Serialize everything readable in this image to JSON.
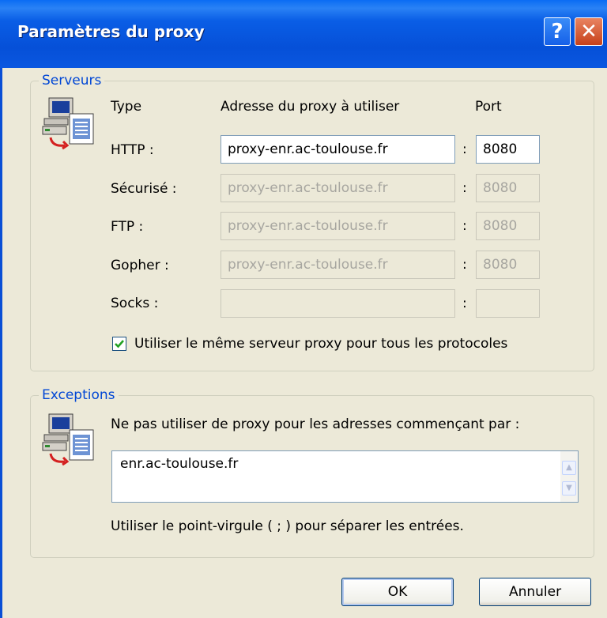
{
  "window": {
    "title": "Paramètres du proxy",
    "help_glyph": "?",
    "close_glyph": "✕"
  },
  "servers": {
    "legend": "Serveurs",
    "icon": "network-server-icon",
    "headers": {
      "type": "Type",
      "address": "Adresse du proxy à utiliser",
      "port": "Port"
    },
    "separator": ":",
    "rows": [
      {
        "label": "HTTP :",
        "address": "proxy-enr.ac-toulouse.fr",
        "port": "8080",
        "enabled": true
      },
      {
        "label": "Sécurisé :",
        "address": "proxy-enr.ac-toulouse.fr",
        "port": "8080",
        "enabled": false
      },
      {
        "label": "FTP :",
        "address": "proxy-enr.ac-toulouse.fr",
        "port": "8080",
        "enabled": false
      },
      {
        "label": "Gopher :",
        "address": "proxy-enr.ac-toulouse.fr",
        "port": "8080",
        "enabled": false
      },
      {
        "label": "Socks :",
        "address": "",
        "port": "",
        "enabled": false
      }
    ],
    "same_proxy_label": "Utiliser le même serveur proxy pour tous les protocoles",
    "same_proxy_checked": true
  },
  "exceptions": {
    "legend": "Exceptions",
    "icon": "network-server-icon",
    "description": "Ne pas utiliser de proxy pour les adresses commençant par :",
    "value": "enr.ac-toulouse.fr",
    "hint": "Utiliser le point-virgule ( ; ) pour séparer les entrées."
  },
  "buttons": {
    "ok": "OK",
    "cancel": "Annuler"
  },
  "colors": {
    "title_bar": "#0a5ee6",
    "legend": "#0046d5",
    "dialog_bg": "#ece9d8",
    "close": "#c7411b"
  }
}
